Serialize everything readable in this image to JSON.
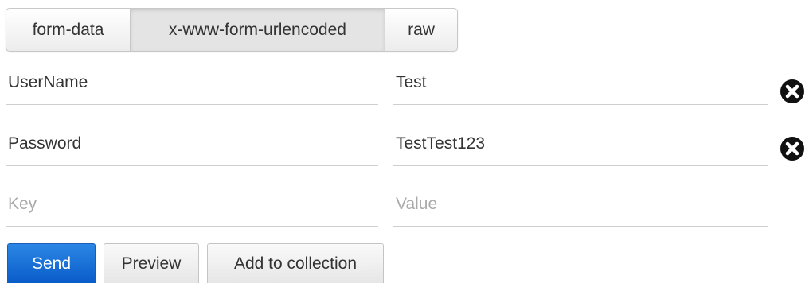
{
  "mode_tabs": [
    {
      "label": "form-data",
      "active": false
    },
    {
      "label": "x-www-form-urlencoded",
      "active": true
    },
    {
      "label": "raw",
      "active": false
    }
  ],
  "params": [
    {
      "key": "UserName",
      "value": "Test"
    },
    {
      "key": "Password",
      "value": "TestTest123"
    }
  ],
  "new_param": {
    "key_placeholder": "Key",
    "value_placeholder": "Value"
  },
  "actions": {
    "send_label": "Send",
    "preview_label": "Preview",
    "add_collection_label": "Add to collection"
  },
  "colors": {
    "send_button": "#0a5cc9",
    "placeholder_text": "#aaaaaa",
    "delete_icon": "#111111"
  },
  "icons": {
    "delete": "remove-circle-icon"
  }
}
